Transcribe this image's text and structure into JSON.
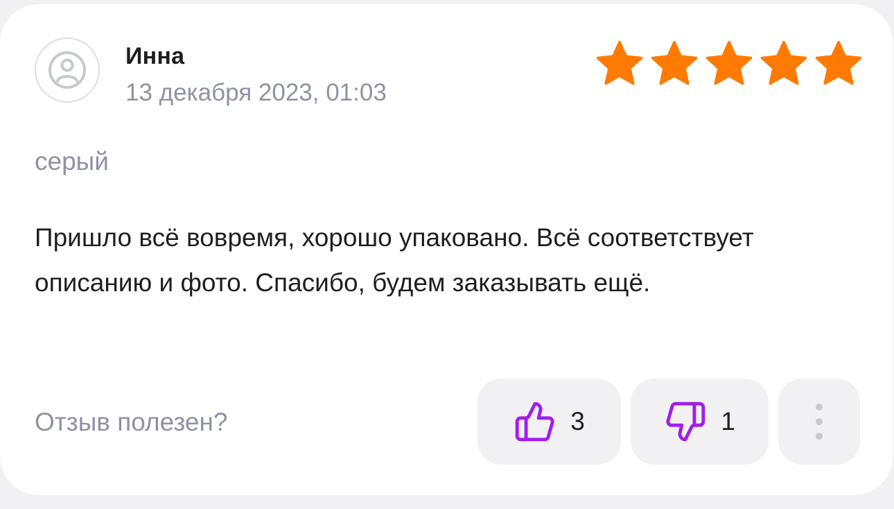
{
  "review": {
    "author": "Инна",
    "date": "13 декабря 2023, 01:03",
    "rating": 5,
    "rating_max": 5,
    "variant": "серый",
    "text": "Пришло всё вовремя, хорошо упаковано. Всё соответствует описанию и фото. Спасибо, будем заказывать ещё."
  },
  "feedback": {
    "question": "Отзыв полезен?",
    "likes": "3",
    "dislikes": "1"
  },
  "icons": {
    "avatar": "user-avatar-icon",
    "like": "thumbs-up-icon",
    "dislike": "thumbs-down-icon",
    "more": "more-vertical-icon",
    "star": "star-icon"
  },
  "colors": {
    "star": "#ff7a00",
    "accent": "#a11ee8",
    "muted_text": "#8f92a6",
    "button_bg": "#f1f1f4"
  }
}
